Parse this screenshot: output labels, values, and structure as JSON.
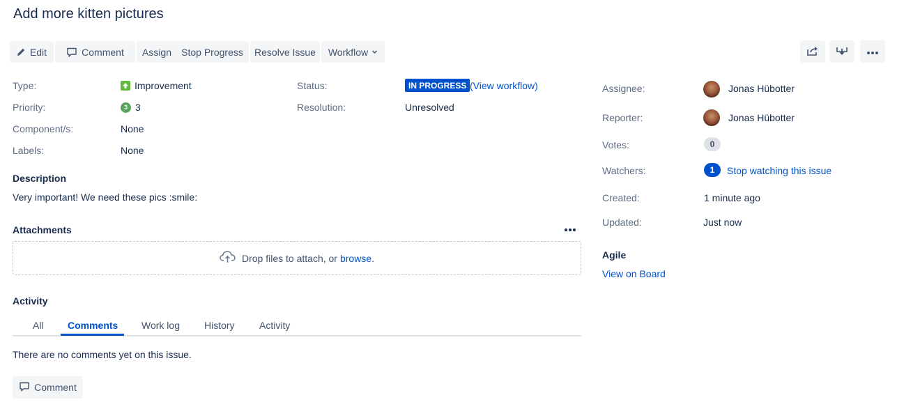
{
  "issue": {
    "title": "Add more kitten pictures"
  },
  "toolbar": {
    "edit": "Edit",
    "comment": "Comment",
    "assign": "Assign",
    "stop_progress": "Stop Progress",
    "resolve_issue": "Resolve Issue",
    "workflow": "Workflow"
  },
  "details": {
    "type_label": "Type:",
    "type_value": "Improvement",
    "priority_label": "Priority:",
    "priority_icon_text": "3",
    "priority_value": "3",
    "components_label": "Component/s:",
    "components_value": "None",
    "labels_label": "Labels:",
    "labels_value": "None",
    "status_label": "Status:",
    "status_value": "IN PROGRESS",
    "view_workflow": "(View workflow)",
    "resolution_label": "Resolution:",
    "resolution_value": "Unresolved"
  },
  "description": {
    "heading": "Description",
    "text": "Very important! We need these pics :smile:"
  },
  "attachments": {
    "heading": "Attachments",
    "drop_text": "Drop files to attach, or ",
    "browse": "browse."
  },
  "activity": {
    "heading": "Activity",
    "tabs": [
      "All",
      "Comments",
      "Work log",
      "History",
      "Activity"
    ],
    "active_tab": "Comments",
    "empty_text": "There are no comments yet on this issue.",
    "comment_button": "Comment"
  },
  "people": {
    "assignee_label": "Assignee:",
    "assignee": "Jonas Hübotter",
    "reporter_label": "Reporter:",
    "reporter": "Jonas Hübotter",
    "votes_label": "Votes:",
    "votes": "0",
    "watchers_label": "Watchers:",
    "watchers": "1",
    "stop_watching": "Stop watching this issue"
  },
  "dates": {
    "created_label": "Created:",
    "created": "1 minute ago",
    "updated_label": "Updated:",
    "updated": "Just now"
  },
  "agile": {
    "heading": "Agile",
    "view_on_board": "View on Board"
  },
  "colors": {
    "primary": "#0052cc",
    "text": "#172b4d",
    "muted": "#5e6c84",
    "button_bg": "#f4f5f7",
    "improvement_green": "#63ba3c",
    "priority_green": "#57a55a"
  },
  "icons": [
    "pencil-icon",
    "comment-icon",
    "chevron-down-icon",
    "share-icon",
    "export-icon",
    "more-icon",
    "upload-cloud-icon"
  ]
}
